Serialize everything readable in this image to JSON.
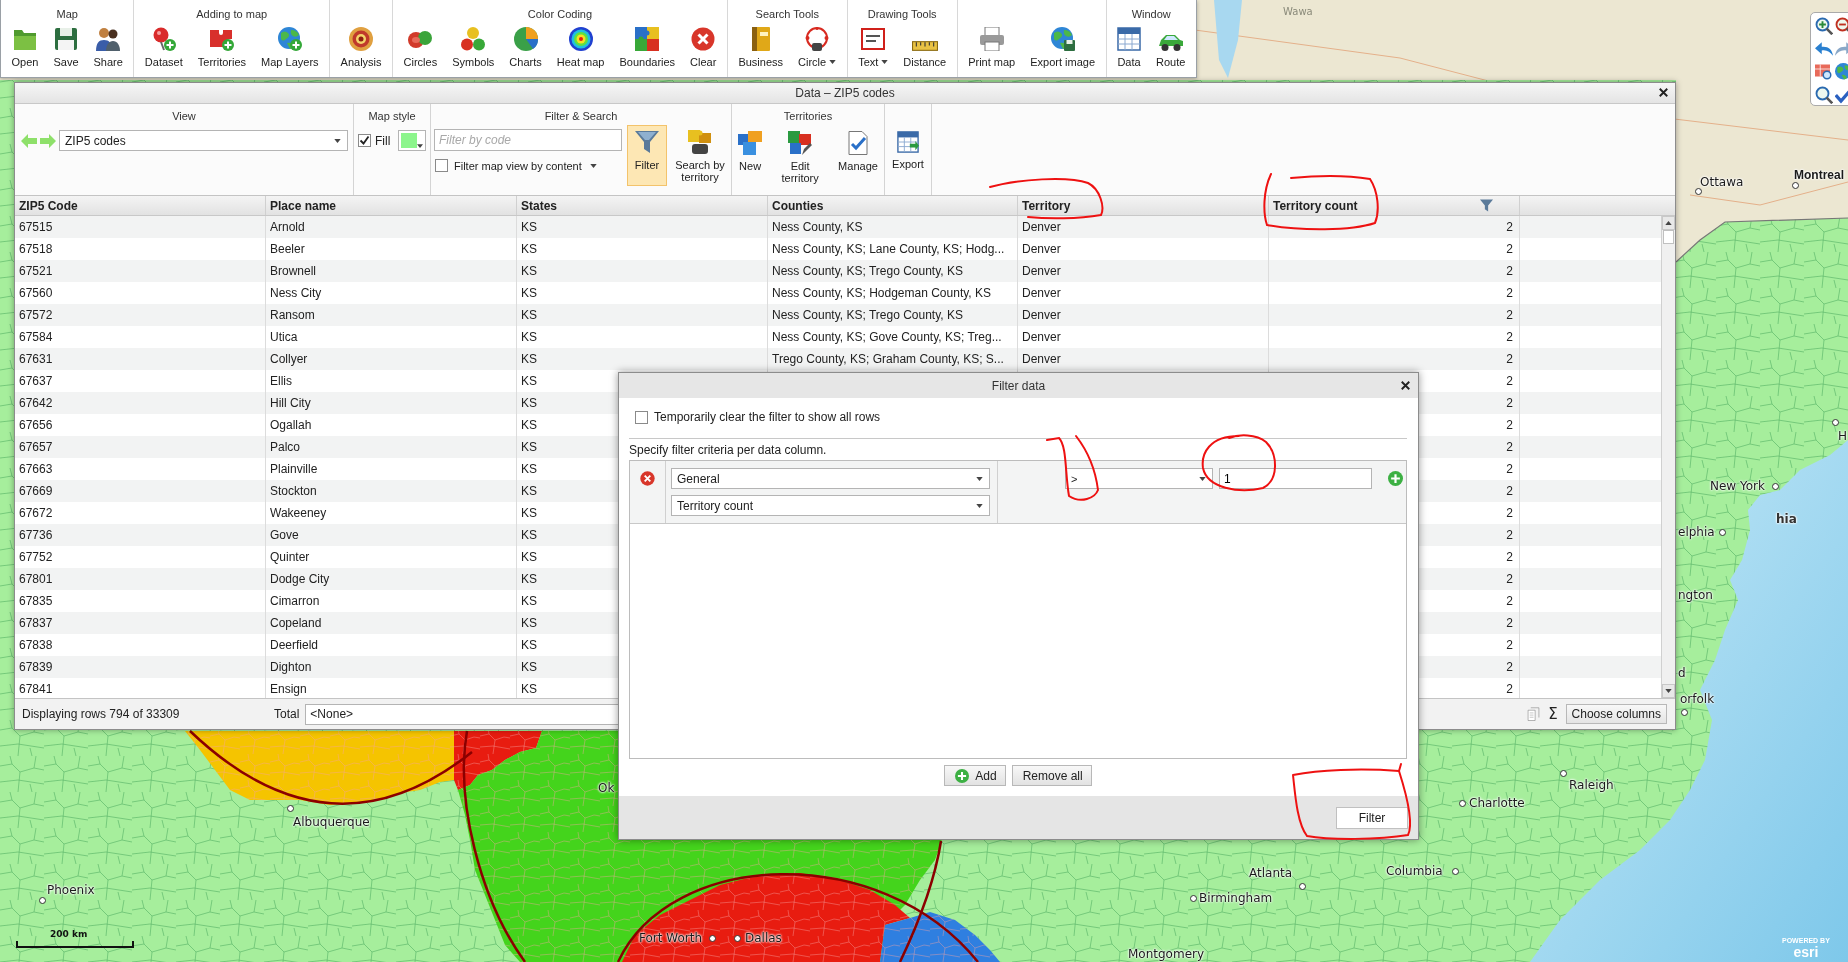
{
  "toolbar": {
    "groups": [
      {
        "title": "Map",
        "buttons": [
          {
            "label": "Open",
            "menu": false
          },
          {
            "label": "Save",
            "menu": false
          },
          {
            "label": "Share",
            "menu": false
          }
        ]
      },
      {
        "title": "Adding to map",
        "buttons": [
          {
            "label": "Dataset",
            "menu": false
          },
          {
            "label": "Territories",
            "menu": false
          },
          {
            "label": "Map Layers",
            "menu": false
          }
        ]
      },
      {
        "buttons": [
          {
            "label": "Analysis",
            "menu": false
          }
        ]
      },
      {
        "title": "Color Coding",
        "buttons": [
          {
            "label": "Circles",
            "menu": false
          },
          {
            "label": "Symbols",
            "menu": false
          },
          {
            "label": "Charts",
            "menu": false
          },
          {
            "label": "Heat map",
            "menu": false
          },
          {
            "label": "Boundaries",
            "menu": false
          },
          {
            "label": "Clear",
            "menu": false
          }
        ]
      },
      {
        "title": "Search Tools",
        "buttons": [
          {
            "label": "Business",
            "menu": false
          },
          {
            "label": "Circle",
            "menu": true
          }
        ]
      },
      {
        "title": "Drawing Tools",
        "buttons": [
          {
            "label": "Text",
            "menu": true
          },
          {
            "label": "Distance",
            "menu": false
          }
        ]
      },
      {
        "buttons": [
          {
            "label": "Print map",
            "menu": false
          },
          {
            "label": "Export image",
            "menu": false
          }
        ]
      },
      {
        "title": "Window",
        "buttons": [
          {
            "label": "Data",
            "menu": false
          },
          {
            "label": "Route",
            "menu": false
          }
        ]
      }
    ]
  },
  "data_window": {
    "title": "Data – ZIP5 codes",
    "ribbon": {
      "view": {
        "title": "View",
        "dropdown": "ZIP5 codes"
      },
      "map_style": {
        "title": "Map style",
        "fill": {
          "label": "Fill",
          "checked": true
        }
      },
      "filter_search": {
        "title": "Filter & Search",
        "placeholder": "Filter by code",
        "map_filter": {
          "label": "Filter map view by content",
          "checked": false
        },
        "buttons": [
          {
            "label": "Filter",
            "selected": true
          },
          {
            "label": "Search by territory",
            "selected": false
          }
        ]
      },
      "territories": {
        "title": "Territories",
        "buttons": [
          {
            "label": "New"
          },
          {
            "label": "Edit territory"
          },
          {
            "label": "Manage"
          }
        ]
      },
      "export": {
        "label": "Export"
      }
    },
    "table": {
      "columns": [
        {
          "label": "ZIP5 Code",
          "filtered": false
        },
        {
          "label": "Place name",
          "filtered": false
        },
        {
          "label": "States",
          "filtered": false
        },
        {
          "label": "Counties",
          "filtered": false
        },
        {
          "label": "Territory",
          "filtered": false
        },
        {
          "label": "Territory count",
          "filtered": true
        }
      ],
      "rows": [
        {
          "zip": "67515",
          "place": "Arnold",
          "state": "KS",
          "counties": "Ness County, KS",
          "territory": "Denver",
          "count": "2"
        },
        {
          "zip": "67518",
          "place": "Beeler",
          "state": "KS",
          "counties": "Ness County, KS; Lane County, KS; Hodg...",
          "territory": "Denver",
          "count": "2"
        },
        {
          "zip": "67521",
          "place": "Brownell",
          "state": "KS",
          "counties": "Ness County, KS; Trego County, KS",
          "territory": "Denver",
          "count": "2"
        },
        {
          "zip": "67560",
          "place": "Ness City",
          "state": "KS",
          "counties": "Ness County, KS; Hodgeman County, KS",
          "territory": "Denver",
          "count": "2"
        },
        {
          "zip": "67572",
          "place": "Ransom",
          "state": "KS",
          "counties": "Ness County, KS; Trego County, KS",
          "territory": "Denver",
          "count": "2"
        },
        {
          "zip": "67584",
          "place": "Utica",
          "state": "KS",
          "counties": "Ness County, KS; Gove County, KS; Treg...",
          "territory": "Denver",
          "count": "2"
        },
        {
          "zip": "67631",
          "place": "Collyer",
          "state": "KS",
          "counties": "Trego County, KS; Graham County, KS; S...",
          "territory": "Denver",
          "count": "2"
        },
        {
          "zip": "67637",
          "place": "Ellis",
          "state": "KS",
          "count": "2"
        },
        {
          "zip": "67642",
          "place": "Hill City",
          "state": "KS",
          "count": "2"
        },
        {
          "zip": "67656",
          "place": "Ogallah",
          "state": "KS",
          "count": "2"
        },
        {
          "zip": "67657",
          "place": "Palco",
          "state": "KS",
          "count": "2"
        },
        {
          "zip": "67663",
          "place": "Plainville",
          "state": "KS",
          "count": "2"
        },
        {
          "zip": "67669",
          "place": "Stockton",
          "state": "KS",
          "count": "2"
        },
        {
          "zip": "67672",
          "place": "Wakeeney",
          "state": "KS",
          "count": "2"
        },
        {
          "zip": "67736",
          "place": "Gove",
          "state": "KS",
          "count": "2"
        },
        {
          "zip": "67752",
          "place": "Quinter",
          "state": "KS",
          "count": "2"
        },
        {
          "zip": "67801",
          "place": "Dodge City",
          "state": "KS",
          "count": "2"
        },
        {
          "zip": "67835",
          "place": "Cimarron",
          "state": "KS",
          "count": "2"
        },
        {
          "zip": "67837",
          "place": "Copeland",
          "state": "KS",
          "count": "2"
        },
        {
          "zip": "67838",
          "place": "Deerfield",
          "state": "KS",
          "count": "2"
        },
        {
          "zip": "67839",
          "place": "Dighton",
          "state": "KS",
          "count": "2"
        },
        {
          "zip": "67841",
          "place": "Ensign",
          "state": "KS",
          "count": "2"
        }
      ]
    },
    "status_bar": {
      "rows_text": "Displaying rows 794 of 33309",
      "total_label": "Total",
      "total_value": "<None>",
      "sum": "Σ",
      "choose_columns": "Choose columns"
    }
  },
  "filter_dialog": {
    "title": "Filter data",
    "clear_filter": {
      "label": "Temporarily clear the filter to show all rows",
      "checked": false
    },
    "instruction": "Specify filter criteria per data column.",
    "criteria": [
      {
        "category": "General",
        "column": "Territory count",
        "operator": ">",
        "value": "1"
      }
    ],
    "actions": [
      {
        "label": "Add",
        "kind": "add"
      },
      {
        "label": "Remove all",
        "kind": "remove"
      }
    ],
    "submit": "Filter"
  },
  "map": {
    "labels": [
      {
        "text": "Wawa",
        "kind": "faint"
      },
      {
        "text": "Ottawa",
        "kind": "city"
      },
      {
        "text": "Montreal",
        "kind": "capital"
      },
      {
        "text": "H",
        "kind": "city"
      },
      {
        "text": "New York",
        "kind": "city"
      },
      {
        "text": "hia",
        "kind": "bold"
      },
      {
        "text": "elphia",
        "kind": "city"
      },
      {
        "text": "ngton",
        "kind": "label"
      },
      {
        "text": "d",
        "kind": "label"
      },
      {
        "text": "orfolk",
        "kind": "city"
      },
      {
        "text": "Raleigh",
        "kind": "city"
      },
      {
        "text": "Charlotte",
        "kind": "city"
      },
      {
        "text": "Columbia",
        "kind": "city"
      },
      {
        "text": "Atlanta",
        "kind": "city"
      },
      {
        "text": "Birmingham",
        "kind": "city"
      },
      {
        "text": "Montgomery",
        "kind": "label"
      },
      {
        "text": "Fort Worth",
        "kind": "city"
      },
      {
        "text": "Dallas",
        "kind": "city"
      },
      {
        "text": "Albuquerque",
        "kind": "city"
      },
      {
        "text": "Phoenix",
        "kind": "city"
      },
      {
        "text": "Ok",
        "kind": "label"
      }
    ],
    "scale": "200 km",
    "attribution": {
      "powered_by": "POWERED BY",
      "logo": "esri"
    }
  }
}
